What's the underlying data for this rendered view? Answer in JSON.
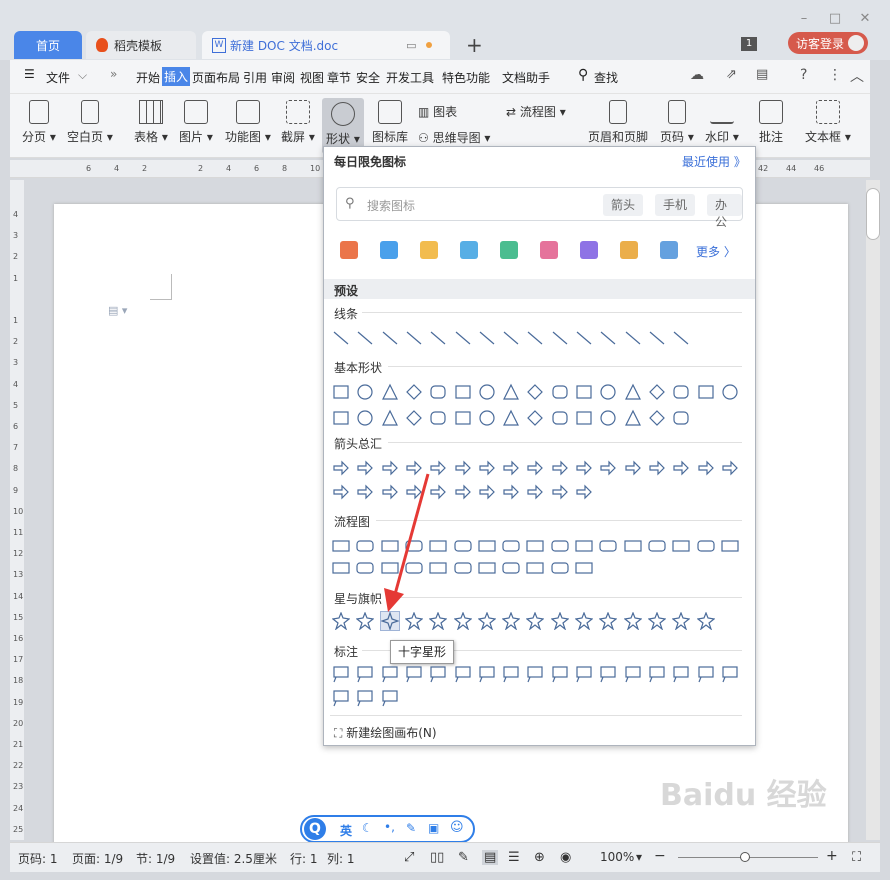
{
  "tabs": {
    "home": "首页",
    "daoke": "稻壳模板",
    "doc": "新建 DOC 文档.doc",
    "badge": "1",
    "visitor": "访客登录"
  },
  "menu": {
    "file": "文件",
    "items": [
      "开始",
      "插入",
      "页面布局",
      "引用",
      "审阅",
      "视图",
      "章节",
      "安全",
      "开发工具",
      "特色功能",
      "文档助手"
    ],
    "search": "查找"
  },
  "ribbon": {
    "page_break": "分页",
    "blank_page": "空白页",
    "table": "表格",
    "picture": "图片",
    "func_chart": "功能图",
    "screenshot": "截屏",
    "shape": "形状",
    "icon_lib": "图标库",
    "chart": "图表",
    "mind_map": "思维导图",
    "flowchart": "流程图",
    "header_footer": "页眉和页脚",
    "page_num": "页码",
    "watermark": "水印",
    "comment": "批注",
    "textbox": "文本框"
  },
  "ruler_h": [
    "6",
    "4",
    "2",
    "",
    "2",
    "4",
    "6",
    "8",
    "10",
    "12",
    "14",
    "16",
    "18",
    "20",
    "22",
    "24",
    "26",
    "28",
    "30",
    "32",
    "34",
    "36",
    "38",
    "40",
    "42",
    "44",
    "46"
  ],
  "ruler_v": [
    "4",
    "3",
    "2",
    "1",
    "",
    "1",
    "2",
    "3",
    "4",
    "5",
    "6",
    "7",
    "8",
    "9",
    "10",
    "11",
    "12",
    "13",
    "14",
    "15",
    "16",
    "17",
    "18",
    "19",
    "20",
    "21",
    "22",
    "23",
    "24",
    "25"
  ],
  "panel": {
    "daily_icons": "每日限免图标",
    "recent": "最近使用 》",
    "search_placeholder": "搜索图标",
    "tags": [
      "箭头",
      "手机",
      "办公"
    ],
    "more": "更多 〉",
    "preset": "预设",
    "lines": "线条",
    "basic": "基本形状",
    "arrows": "箭头总汇",
    "flow": "流程图",
    "stars": "星与旗帜",
    "callouts": "标注",
    "new_canvas": "新建绘图画布(N)",
    "tooltip": "十字星形"
  },
  "status": {
    "page_code": "页码: 1",
    "pages": "页面: 1/9",
    "section": "节: 1/9",
    "setting": "设置值: 2.5厘米",
    "row": "行: 1",
    "col": "列: 1",
    "zoom": "100%"
  },
  "ime": {
    "lang": "英"
  },
  "watermark": "Baidu 经验"
}
